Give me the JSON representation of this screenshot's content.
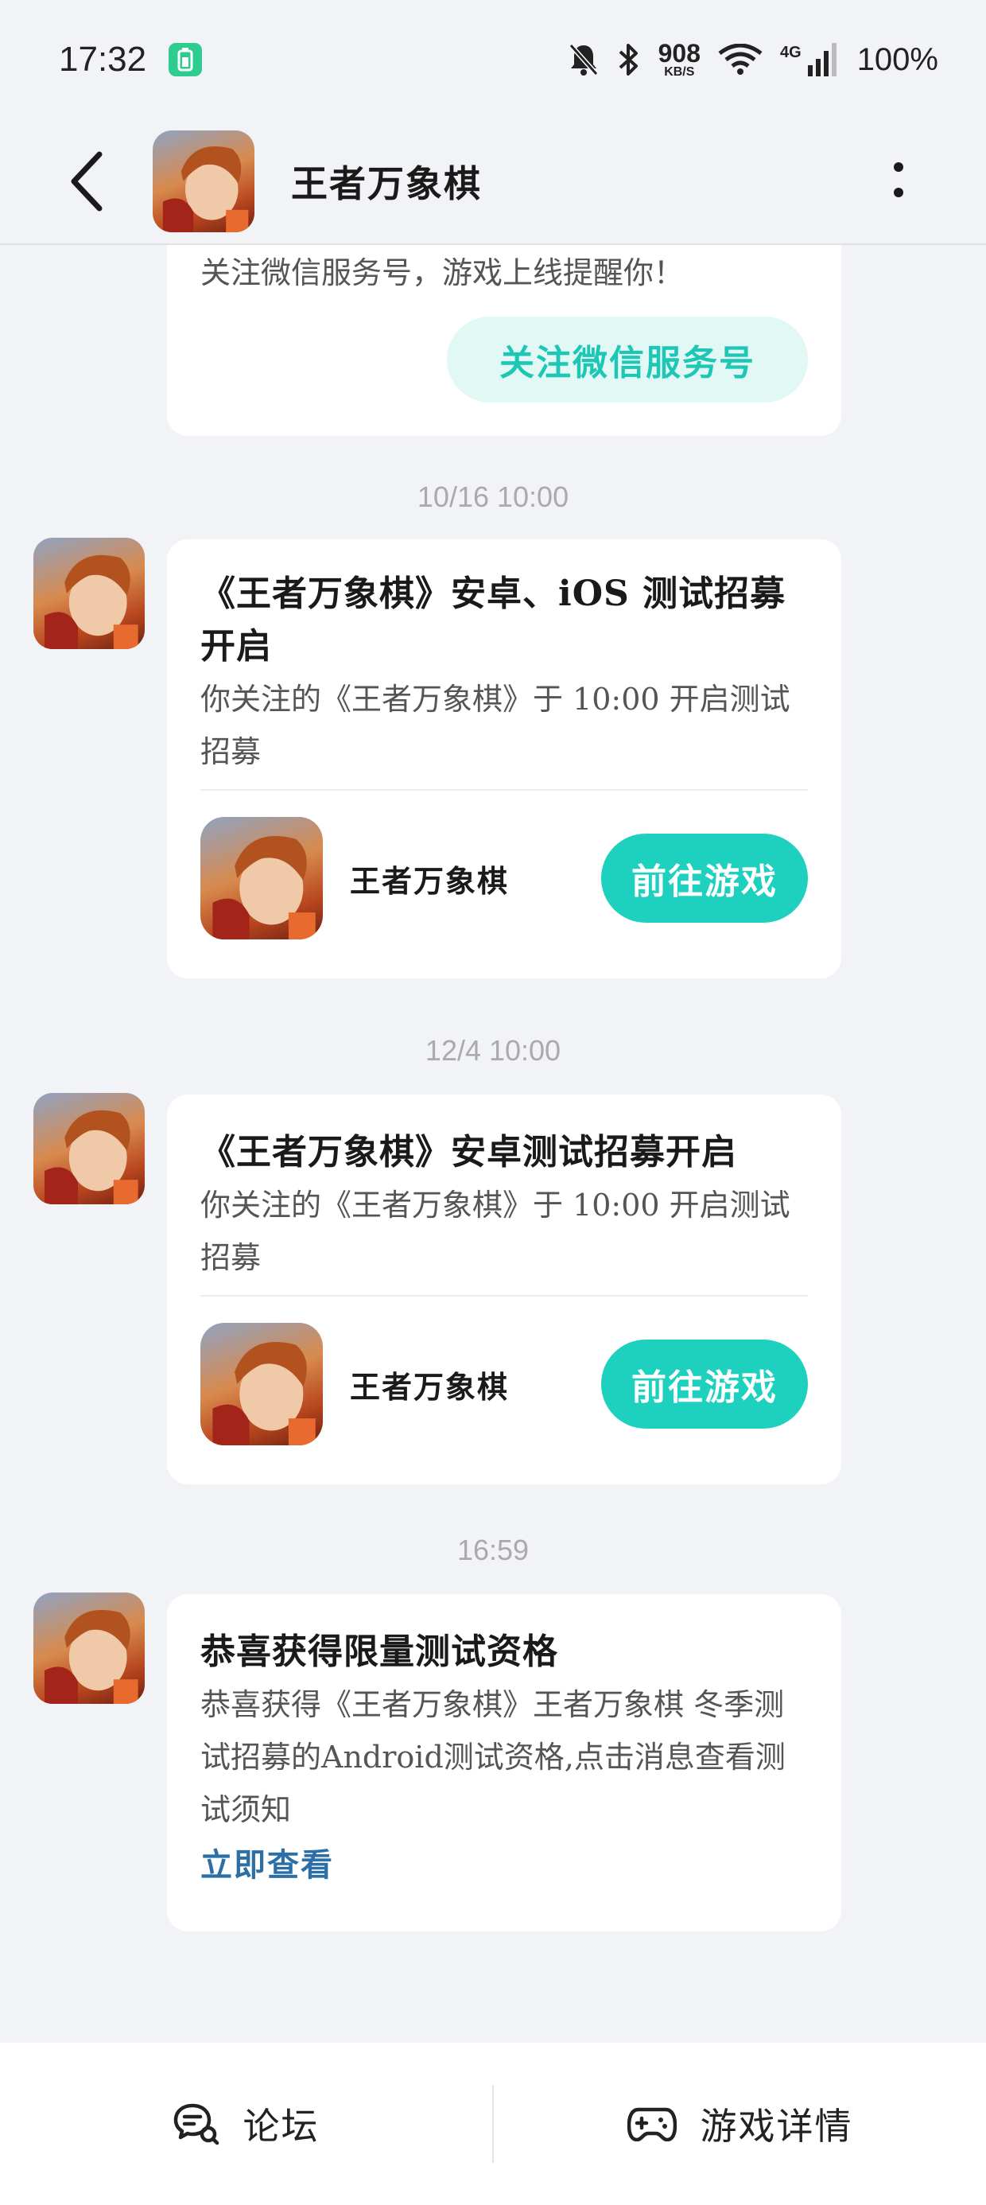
{
  "status_bar": {
    "time": "17:32",
    "net_speed_value": "908",
    "net_speed_unit": "KB/S",
    "network_type": "4G",
    "battery": "100%"
  },
  "header": {
    "title": "王者万象棋"
  },
  "messages": [
    {
      "partial_text": "关注微信服务号，游戏上线提醒你！",
      "button": "关注微信服务号"
    },
    {
      "timestamp": "10/16  10:00",
      "title": "《王者万象棋》安卓、iOS 测试招募开启",
      "desc": "你关注的《王者万象棋》于 10:00 开启测试招募",
      "game_name": "王者万象棋",
      "button": "前往游戏"
    },
    {
      "timestamp": "12/4  10:00",
      "title": "《王者万象棋》安卓测试招募开启",
      "desc": "你关注的《王者万象棋》于 10:00 开启测试招募",
      "game_name": "王者万象棋",
      "button": "前往游戏"
    },
    {
      "timestamp": "16:59",
      "title": "恭喜获得限量测试资格",
      "desc": "恭喜获得《王者万象棋》王者万象棋 冬季测试招募的Android测试资格,点击消息查看测试须知",
      "link": "立即查看"
    }
  ],
  "bottom_bar": {
    "forum": "论坛",
    "game_details": "游戏详情"
  },
  "colors": {
    "accent": "#1ed1bf",
    "link": "#2c6fa6",
    "background": "#f2f3f7"
  },
  "icons": [
    "battery-saver-icon",
    "mute-icon",
    "bluetooth-icon",
    "wifi-icon",
    "signal-icon",
    "back-icon",
    "more-icon",
    "forum-icon",
    "gamepad-icon"
  ]
}
